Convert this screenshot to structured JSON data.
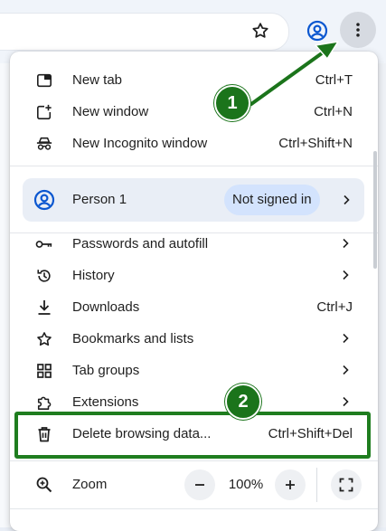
{
  "menu": {
    "items_top": [
      {
        "label": "New tab",
        "shortcut": "Ctrl+T",
        "icon": "new-tab-icon"
      },
      {
        "label": "New window",
        "shortcut": "Ctrl+N",
        "icon": "new-window-icon"
      },
      {
        "label": "New Incognito window",
        "shortcut": "Ctrl+Shift+N",
        "icon": "incognito-icon"
      }
    ],
    "profile": {
      "name": "Person 1",
      "status": "Not signed in",
      "icon": "account-circle-icon"
    },
    "items_main": [
      {
        "label": "Passwords and autofill",
        "icon": "key-icon",
        "has_submenu": true
      },
      {
        "label": "History",
        "icon": "history-icon",
        "has_submenu": true
      },
      {
        "label": "Downloads",
        "shortcut": "Ctrl+J",
        "icon": "download-icon"
      },
      {
        "label": "Bookmarks and lists",
        "icon": "star-icon",
        "has_submenu": true
      },
      {
        "label": "Tab groups",
        "icon": "tab-groups-icon",
        "has_submenu": true
      },
      {
        "label": "Extensions",
        "icon": "extension-icon",
        "has_submenu": true
      },
      {
        "label": "Delete browsing data...",
        "shortcut": "Ctrl+Shift+Del",
        "icon": "trash-icon"
      }
    ],
    "zoom": {
      "label": "Zoom",
      "value": "100%",
      "minus": "−",
      "plus": "+",
      "icon": "zoom-icon"
    }
  },
  "annotations": {
    "step1": "1",
    "step2": "2",
    "color": "#1b741b"
  },
  "toolbar": {
    "icons": [
      "bookmark-star-icon",
      "profile-icon",
      "more-vert-icon"
    ]
  }
}
